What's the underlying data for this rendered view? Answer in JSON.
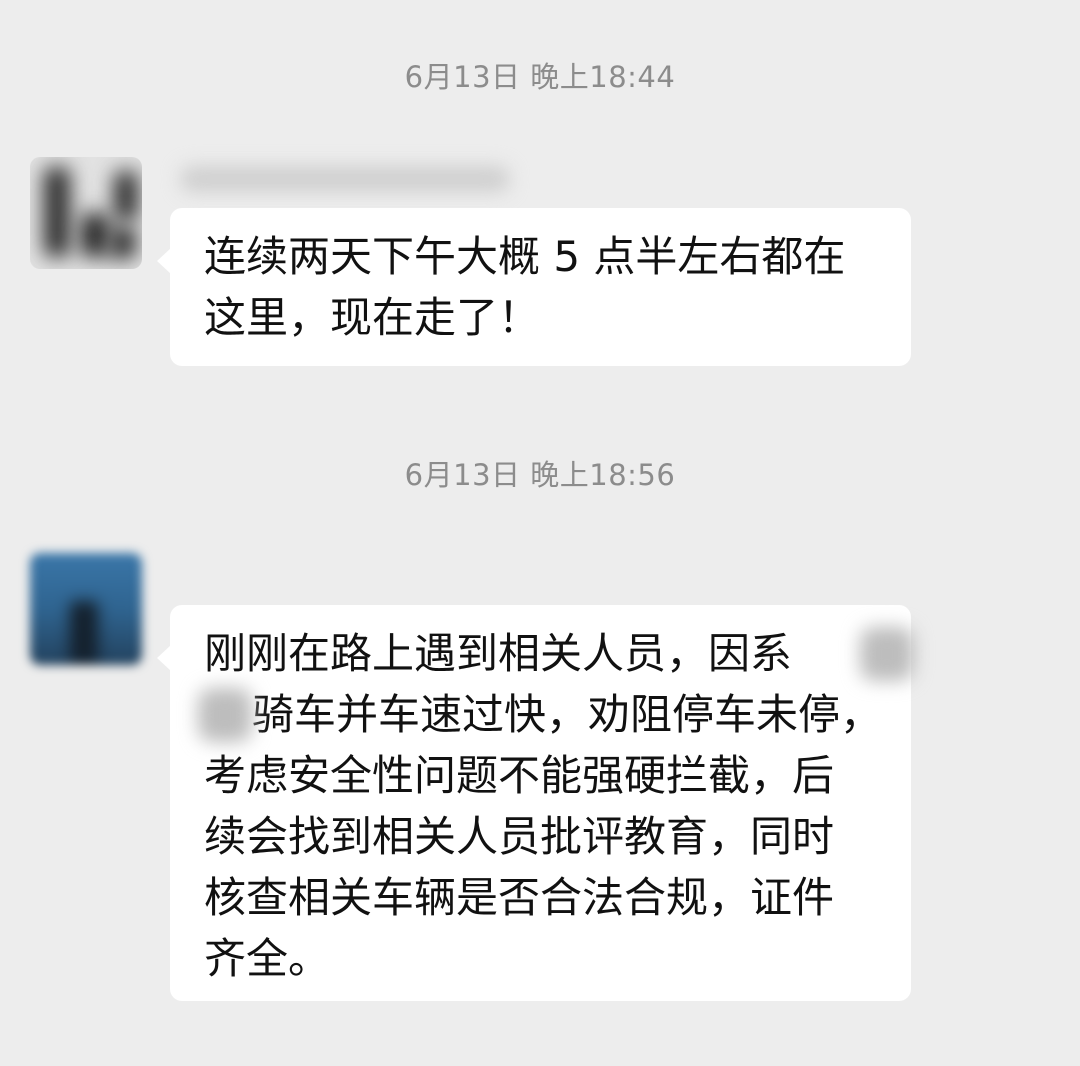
{
  "conversation": {
    "messages": [
      {
        "timestamp": "6月13日 晚上18:44",
        "sender_name": "",
        "lines": [
          "连续两天下午大概 5 点半左右都在",
          "这里，现在走了！"
        ]
      },
      {
        "timestamp": "6月13日 晚上18:56",
        "lines": [
          "刚刚在路上遇到相关人员，因系",
          "骑车并车速过快，劝阻停车未停，",
          "考虑安全性问题不能强硬拦截，后",
          "续会找到相关人员批评教育，同时",
          "核查相关车辆是否合法合规，证件",
          "齐全。"
        ]
      }
    ]
  },
  "colors": {
    "background": "#ededed",
    "bubble": "#ffffff",
    "timestamp_text": "#8c8c8c",
    "message_text": "#111111"
  }
}
